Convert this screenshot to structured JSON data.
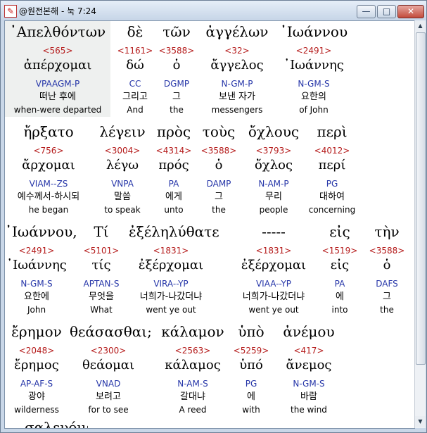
{
  "window": {
    "title": "@원전본해 - 눅 7:24"
  },
  "controls": {
    "minimize": "—",
    "maximize": "□",
    "close": "✕"
  },
  "rows": [
    {
      "words": [
        {
          "greek": "᾽Απελθόντων",
          "strongs": "<565>",
          "lemma": "ἀπέρχομαι",
          "parse": "VPAAGM-P",
          "korean": "떠난 후에",
          "english": "when-were departed",
          "highlight": true
        },
        {
          "greek": "δὲ",
          "strongs": "<1161>",
          "lemma": "δώ",
          "parse": "CC",
          "korean": "그리고",
          "english": "And"
        },
        {
          "greek": "τῶν",
          "strongs": "<3588>",
          "lemma": "ὁ",
          "parse": "DGMP",
          "korean": "그",
          "english": "the"
        },
        {
          "greek": "ἀγγέλων",
          "strongs": "<32>",
          "lemma": "ἄγγελος",
          "parse": "N-GM-P",
          "korean": "보낸 자가",
          "english": "messengers"
        },
        {
          "greek": "᾽Ιωάννου",
          "strongs": "<2491>",
          "lemma": "᾽Ιωάννης",
          "parse": "N-GM-S",
          "korean": "요한의",
          "english": "of John"
        }
      ]
    },
    {
      "words": [
        {
          "greek": "ἤρξατο",
          "strongs": "<756>",
          "lemma": "ἄρχομαι",
          "parse": "VIAM--ZS",
          "korean": "예수께서-하시되",
          "english": "he began"
        },
        {
          "greek": "λέγειν",
          "strongs": "<3004>",
          "lemma": "λέγω",
          "parse": "VNPA",
          "korean": "말씀",
          "english": "to speak"
        },
        {
          "greek": "πρὸς",
          "strongs": "<4314>",
          "lemma": "πρός",
          "parse": "PA",
          "korean": "에게",
          "english": "unto"
        },
        {
          "greek": "τοὺς",
          "strongs": "<3588>",
          "lemma": "ὁ",
          "parse": "DAMP",
          "korean": "그",
          "english": "the"
        },
        {
          "greek": "ὄχλους",
          "strongs": "<3793>",
          "lemma": "ὄχλος",
          "parse": "N-AM-P",
          "korean": "무리",
          "english": "people"
        },
        {
          "greek": "περὶ",
          "strongs": "<4012>",
          "lemma": "περί",
          "parse": "PG",
          "korean": "대하여",
          "english": "concerning"
        }
      ]
    },
    {
      "words": [
        {
          "greek": "᾽Ιωάννου,",
          "strongs": "<2491>",
          "lemma": "᾽Ιωάννης",
          "parse": "N-GM-S",
          "korean": "요한에",
          "english": "John"
        },
        {
          "greek": "Τί",
          "strongs": "<5101>",
          "lemma": "τίς",
          "parse": "APTAN-S",
          "korean": "무엇을",
          "english": "What"
        },
        {
          "greek": "ἐξέληλύθατε",
          "strongs": "<1831>",
          "lemma": "ἐξέρχομαι",
          "parse": "VIRA--YP",
          "korean": "너희가-나갔더냐",
          "english": "went ye out"
        },
        {
          "greek": "-----",
          "strongs": "<1831>",
          "lemma": "ἐξέρχομαι",
          "parse": "VIAA--YP",
          "korean": "너희가-나갔더냐",
          "english": "went ye out"
        },
        {
          "greek": "εἰς",
          "strongs": "<1519>",
          "lemma": "εἰς",
          "parse": "PA",
          "korean": "에",
          "english": "into"
        },
        {
          "greek": "τὴν",
          "strongs": "<3588>",
          "lemma": "ὁ",
          "parse": "DAFS",
          "korean": "그",
          "english": "the"
        }
      ]
    },
    {
      "words": [
        {
          "greek": "ἔρημον",
          "strongs": "<2048>",
          "lemma": "ἔρημος",
          "parse": "AP-AF-S",
          "korean": "광야",
          "english": "wilderness"
        },
        {
          "greek": "θεάσασθαι;",
          "strongs": "<2300>",
          "lemma": "θεάομαι",
          "parse": "VNAD",
          "korean": "보려고",
          "english": "for to see"
        },
        {
          "greek": "κάλαμον",
          "strongs": "<2563>",
          "lemma": "κάλαμος",
          "parse": "N-AM-S",
          "korean": "갈대냐",
          "english": "A reed"
        },
        {
          "greek": "ὑπὸ",
          "strongs": "<5259>",
          "lemma": "ὑπό",
          "parse": "PG",
          "korean": "에",
          "english": "with"
        },
        {
          "greek": "ἀνέμου",
          "strongs": "<417>",
          "lemma": "ἄνεμος",
          "parse": "N-GM-S",
          "korean": "바람",
          "english": "the wind"
        }
      ]
    }
  ],
  "partial_next_row": "σαλευόμενον"
}
